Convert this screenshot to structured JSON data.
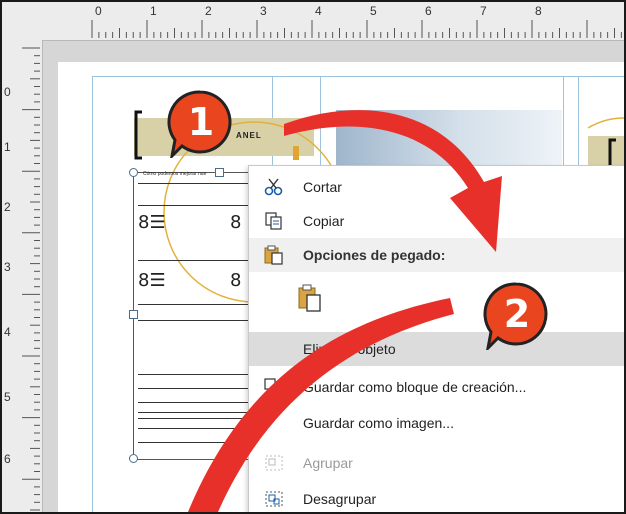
{
  "rulers": {
    "horizontal": [
      "0",
      "1",
      "2",
      "3",
      "4",
      "5",
      "6",
      "7",
      "8"
    ],
    "vertical": [
      "0",
      "1",
      "2",
      "3",
      "4",
      "5",
      "6"
    ]
  },
  "document": {
    "panel_text": "ANEL",
    "tiny_caption": "Cómo podemos mejorar nue"
  },
  "context_menu": {
    "cut": "Cortar",
    "copy": "Copiar",
    "paste_options": "Opciones de pegado:",
    "delete_object": "Eliminar objeto",
    "save_as_building_block": "Guardar como bloque de creación...",
    "save_as_picture": "Guardar como imagen...",
    "group": "Agrupar",
    "ungroup": "Desagrupar"
  },
  "callouts": {
    "step1": "1",
    "step2": "2"
  },
  "colors": {
    "arrow_red": "#e8302a",
    "badge_orange": "#e9451f",
    "highlight": "#dcdcdc"
  }
}
